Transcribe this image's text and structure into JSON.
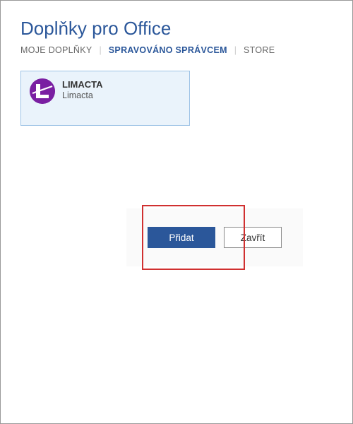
{
  "dialog": {
    "title": "Doplňky pro Office"
  },
  "tabs": {
    "my_addins": "MOJE DOPLŇKY",
    "admin_managed": "SPRAVOVÁNO SPRÁVCEM",
    "store": "STORE",
    "separator": "|"
  },
  "addins": [
    {
      "name": "LIMACTA",
      "publisher": "Limacta",
      "icon": "limacta-logo",
      "selected": true
    }
  ],
  "footer": {
    "add_label": "Přidat",
    "close_label": "Zavřít"
  },
  "colors": {
    "accent": "#2b579a",
    "card_bg": "#eaf3fb",
    "card_border": "#9ec3e6",
    "icon_bg": "#7a1fa2",
    "highlight": "#d03030"
  }
}
